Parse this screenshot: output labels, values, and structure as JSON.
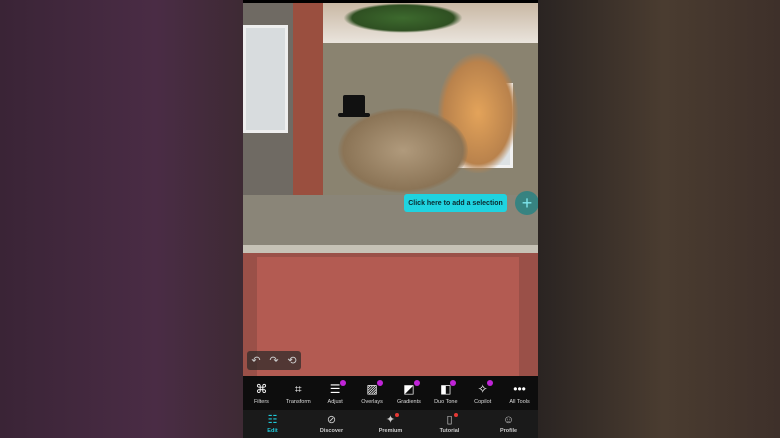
{
  "canvas": {
    "selection_button": "Click here to add a selection",
    "add_icon": "plus-icon"
  },
  "history": {
    "undo": "↶",
    "redo": "↷",
    "reset": "⟲"
  },
  "tools": [
    {
      "label": "Filters",
      "icon": "⌘",
      "badge": false
    },
    {
      "label": "Transform",
      "icon": "⌗",
      "badge": false
    },
    {
      "label": "Adjust",
      "icon": "☰",
      "badge": true
    },
    {
      "label": "Overlays",
      "icon": "▨",
      "badge": true
    },
    {
      "label": "Gradients",
      "icon": "◩",
      "badge": true
    },
    {
      "label": "Duo Tone",
      "icon": "◧",
      "badge": true
    },
    {
      "label": "Copilot",
      "icon": "✧",
      "badge": true
    },
    {
      "label": "All Tools",
      "icon": "•••",
      "badge": false
    }
  ],
  "nav": [
    {
      "label": "Edit",
      "icon": "☷",
      "active": true,
      "dot": false
    },
    {
      "label": "Discover",
      "icon": "⊘",
      "active": false,
      "dot": false
    },
    {
      "label": "Premium",
      "icon": "✦",
      "active": false,
      "dot": true
    },
    {
      "label": "Tutorial",
      "icon": "▯",
      "active": false,
      "dot": true
    },
    {
      "label": "Profile",
      "icon": "☺",
      "active": false,
      "dot": false
    }
  ],
  "colors": {
    "accent": "#1fd3e0",
    "badge": "#c024d8",
    "dot": "#e53935"
  }
}
